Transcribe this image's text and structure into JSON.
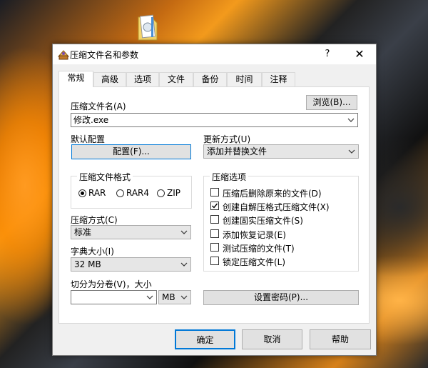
{
  "window": {
    "title": "压缩文件名和参数",
    "help_btn": "?",
    "close_btn": "✕"
  },
  "tabs": [
    "常规",
    "高级",
    "选项",
    "文件",
    "备份",
    "时间",
    "注释"
  ],
  "archive_name": {
    "label": "压缩文件名(A)",
    "value": "修改.exe",
    "browse_button": "浏览(B)..."
  },
  "default_profile": {
    "label": "默认配置",
    "button": "配置(F)..."
  },
  "update_mode": {
    "label": "更新方式(U)",
    "value": "添加并替换文件"
  },
  "format": {
    "title": "压缩文件格式",
    "options": [
      "RAR",
      "RAR4",
      "ZIP"
    ],
    "selected": "RAR"
  },
  "compression_method": {
    "label": "压缩方式(C)",
    "value": "标准"
  },
  "dictionary_size": {
    "label": "字典大小(I)",
    "value": "32 MB"
  },
  "split": {
    "label": "切分为分卷(V)，大小",
    "value": "",
    "unit": "MB"
  },
  "archive_options": {
    "title": "压缩选项",
    "items": [
      {
        "label": "压缩后删除原来的文件(D)",
        "checked": false
      },
      {
        "label": "创建自解压格式压缩文件(X)",
        "checked": true
      },
      {
        "label": "创建固实压缩文件(S)",
        "checked": false
      },
      {
        "label": "添加恢复记录(E)",
        "checked": false
      },
      {
        "label": "测试压缩的文件(T)",
        "checked": false
      },
      {
        "label": "锁定压缩文件(L)",
        "checked": false
      }
    ]
  },
  "set_password_button": "设置密码(P)...",
  "footer": {
    "ok": "确定",
    "cancel": "取消",
    "help": "帮助"
  },
  "colors": {
    "accent": "#0078d7",
    "dialog_bg": "#f0f0f0",
    "panel_bg": "#ffffff"
  }
}
